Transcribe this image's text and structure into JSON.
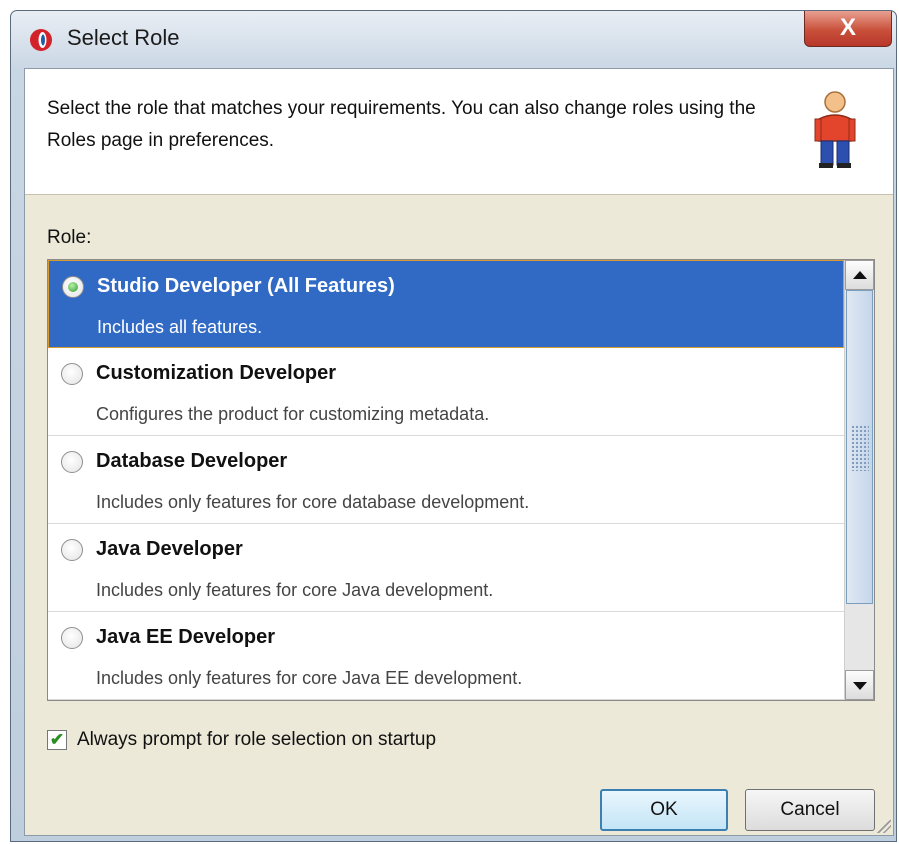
{
  "window": {
    "title": "Select Role",
    "close_label": "X"
  },
  "header": {
    "text": "Select the role that matches your requirements. You can also change roles using the Roles page in preferences."
  },
  "role_label": "Role:",
  "roles": [
    {
      "title": "Studio Developer (All Features)",
      "description": "Includes all features.",
      "selected": true
    },
    {
      "title": "Customization Developer",
      "description": "Configures the product for customizing metadata.",
      "selected": false
    },
    {
      "title": "Database Developer",
      "description": "Includes only features for core database development.",
      "selected": false
    },
    {
      "title": "Java Developer",
      "description": "Includes only features for core Java development.",
      "selected": false
    },
    {
      "title": "Java EE Developer",
      "description": "Includes only features for core Java EE development.",
      "selected": false
    }
  ],
  "prompt_checkbox": {
    "label": "Always prompt for role selection on startup",
    "checked": true
  },
  "buttons": {
    "ok": "OK",
    "cancel": "Cancel"
  },
  "colors": {
    "selection": "#316ac5",
    "selection_border": "#d99a2f",
    "dialog_bg": "#ece9d8"
  }
}
